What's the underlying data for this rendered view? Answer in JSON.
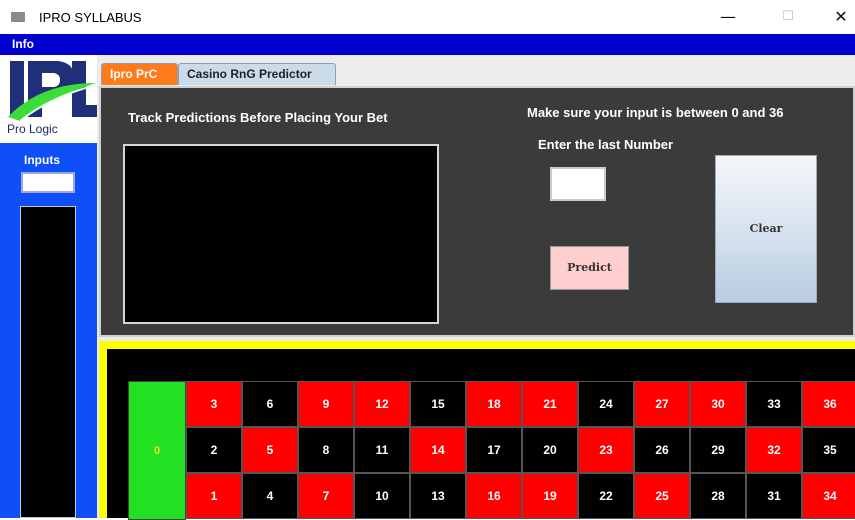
{
  "window": {
    "title": "IPRO SYLLABUS",
    "controls": {
      "minimize": "—",
      "maximize": "☐",
      "close": "✕"
    }
  },
  "menu": {
    "info": "Info"
  },
  "logo": {
    "text": "Pro Logic",
    "letters": "IPL"
  },
  "left_panel": {
    "inputs_label": "Inputs",
    "inputs_value": ""
  },
  "tabs": [
    {
      "label": "Ipro PrC",
      "active": false
    },
    {
      "label": "Casino RnG Predictor",
      "active": true
    }
  ],
  "predictor": {
    "track_title": "Track Predictions Before Placing Your Bet",
    "make_sure": "Make sure your input is between 0 and 36",
    "enter_last": "Enter the last Number",
    "number_value": "",
    "predict_label": "Predict",
    "clear_label": "Clear"
  },
  "roulette": {
    "zero": "0",
    "rows": [
      [
        {
          "n": "3",
          "color": "red"
        },
        {
          "n": "6",
          "color": "black"
        },
        {
          "n": "9",
          "color": "red"
        },
        {
          "n": "12",
          "color": "red"
        },
        {
          "n": "15",
          "color": "black"
        },
        {
          "n": "18",
          "color": "red"
        },
        {
          "n": "21",
          "color": "red"
        },
        {
          "n": "24",
          "color": "black"
        },
        {
          "n": "27",
          "color": "red"
        },
        {
          "n": "30",
          "color": "red"
        },
        {
          "n": "33",
          "color": "black"
        },
        {
          "n": "36",
          "color": "red"
        }
      ],
      [
        {
          "n": "2",
          "color": "black"
        },
        {
          "n": "5",
          "color": "red"
        },
        {
          "n": "8",
          "color": "black"
        },
        {
          "n": "11",
          "color": "black"
        },
        {
          "n": "14",
          "color": "red"
        },
        {
          "n": "17",
          "color": "black"
        },
        {
          "n": "20",
          "color": "black"
        },
        {
          "n": "23",
          "color": "red"
        },
        {
          "n": "26",
          "color": "black"
        },
        {
          "n": "29",
          "color": "black"
        },
        {
          "n": "32",
          "color": "red"
        },
        {
          "n": "35",
          "color": "black"
        }
      ],
      [
        {
          "n": "1",
          "color": "red"
        },
        {
          "n": "4",
          "color": "black"
        },
        {
          "n": "7",
          "color": "red"
        },
        {
          "n": "10",
          "color": "black"
        },
        {
          "n": "13",
          "color": "black"
        },
        {
          "n": "16",
          "color": "red"
        },
        {
          "n": "19",
          "color": "red"
        },
        {
          "n": "22",
          "color": "black"
        },
        {
          "n": "25",
          "color": "red"
        },
        {
          "n": "28",
          "color": "black"
        },
        {
          "n": "31",
          "color": "black"
        },
        {
          "n": "34",
          "color": "red"
        }
      ]
    ]
  },
  "colors": {
    "menubar": "#0000d0",
    "left_panel": "#0f4ff7",
    "tab_ipro": "#ff7a1a",
    "zero": "#22e022",
    "red": "#ff0000",
    "frame": "#ffff00"
  }
}
